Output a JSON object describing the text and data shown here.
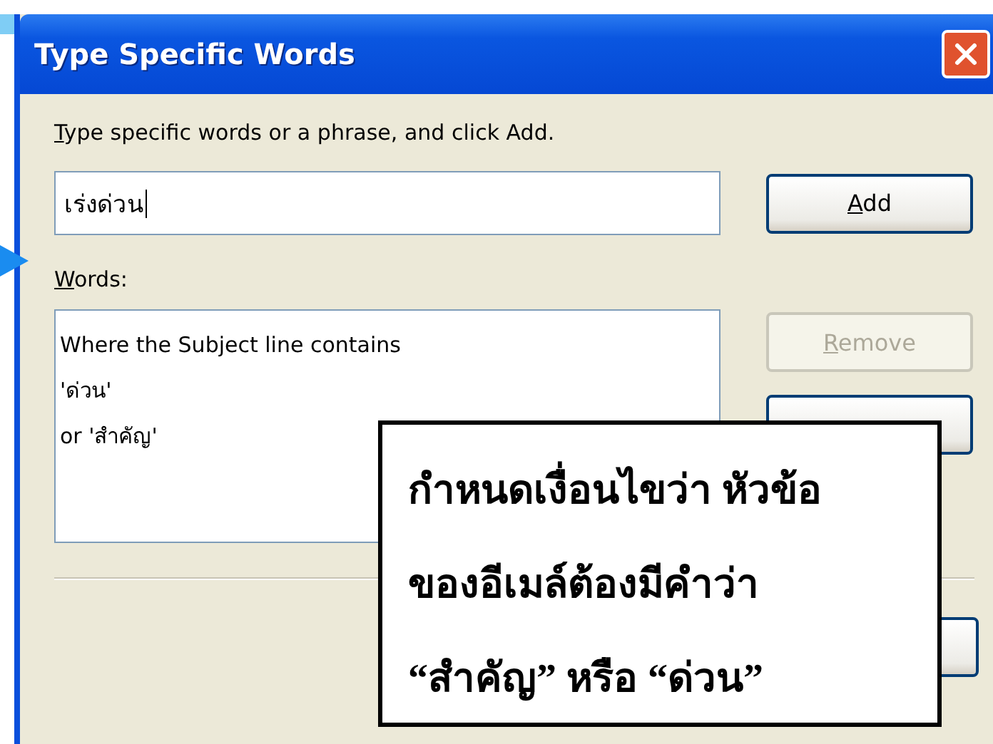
{
  "window": {
    "title": "Type Specific Words"
  },
  "instruction": {
    "text": "Type specific words or a phrase, and click Add."
  },
  "input": {
    "value": "เร่งด่วน"
  },
  "buttons": [
    {
      "label": "Add",
      "disabled": false
    },
    {
      "label": "Remove",
      "disabled": true
    }
  ],
  "words": {
    "label": "Words:",
    "items": [
      "Where the Subject line contains",
      "'ด่วน'",
      "or 'สำคัญ'"
    ]
  },
  "callout": {
    "lines": [
      "กำหนดเงื่อนไขว่า หัวข้อ",
      "ของอีเมล์ต้องมีคำว่า",
      "“สำคัญ” หรือ “ด่วน”"
    ]
  }
}
